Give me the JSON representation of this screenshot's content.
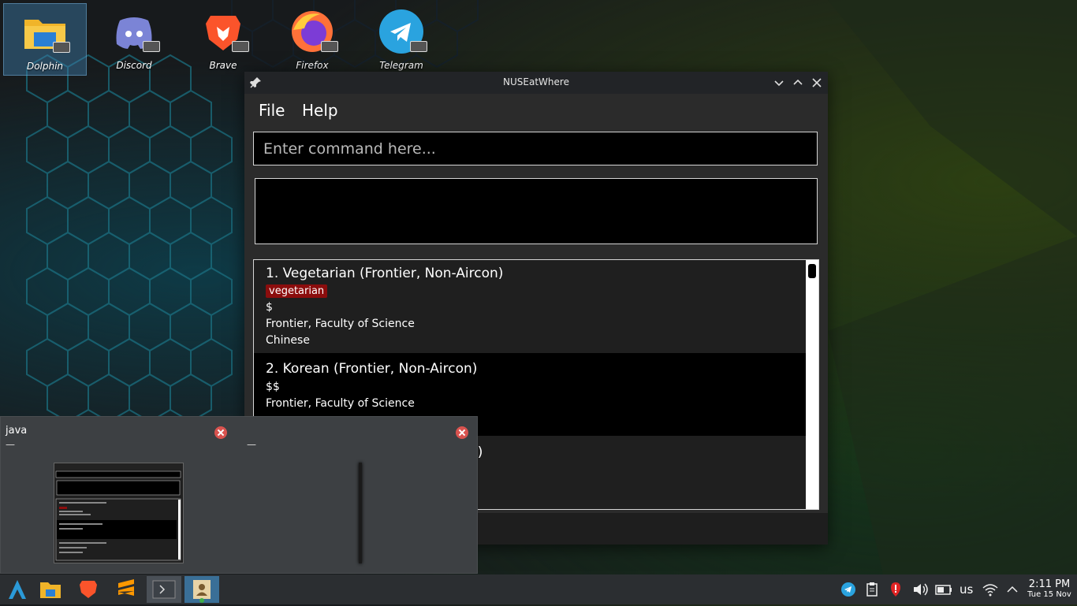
{
  "desktop": {
    "icons": [
      {
        "label": "Dolphin"
      },
      {
        "label": "Discord"
      },
      {
        "label": "Brave"
      },
      {
        "label": "Firefox"
      },
      {
        "label": "Telegram"
      }
    ]
  },
  "window": {
    "title": "NUSEatWhere",
    "menu": [
      "File",
      "Help"
    ],
    "command_placeholder": "Enter command here...",
    "result_text": "",
    "restaurants": [
      {
        "title": "1.  Vegetarian (Frontier, Non-Aircon)",
        "tag": "vegetarian",
        "price": "$",
        "location": "Frontier, Faculty of Science",
        "cuisine": "Chinese"
      },
      {
        "title": "2.  Korean (Frontier, Non-Aircon)",
        "price": "$$",
        "location": "Frontier, Faculty of Science"
      },
      {
        "title_fragment": "n)"
      }
    ]
  },
  "task_switcher": {
    "windows": [
      {
        "title": "java",
        "subtitle": "—"
      },
      {
        "title": "",
        "subtitle": "—"
      }
    ]
  },
  "taskbar": {
    "language": "us",
    "time": "2:11 PM",
    "date": "Tue 15 Nov"
  }
}
